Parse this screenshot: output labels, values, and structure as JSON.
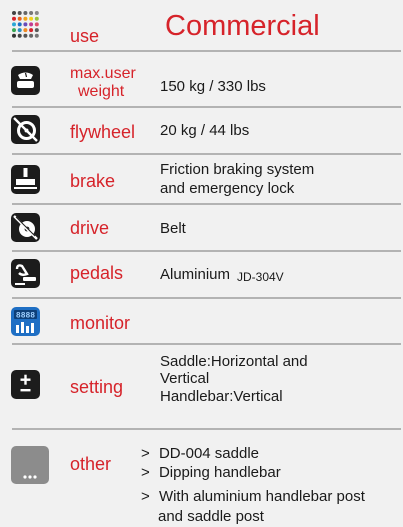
{
  "rows": {
    "use": {
      "label": "use",
      "value": "Commercial"
    },
    "max_user_weight": {
      "label_line1": "max.user",
      "label_line2": "weight",
      "value": "150 kg / 330 lbs"
    },
    "flywheel": {
      "label": "flywheel",
      "value": "20 kg / 44 lbs"
    },
    "brake": {
      "label": "brake",
      "value_line1": "Friction braking system",
      "value_line2": "and emergency lock"
    },
    "drive": {
      "label": "drive",
      "value": "Belt"
    },
    "pedals": {
      "label": "pedals",
      "value": "Aluminium",
      "model": "JD-304V"
    },
    "monitor": {
      "label": "monitor",
      "display_digits": "8888"
    },
    "setting": {
      "label": "setting",
      "value_line1": "Saddle:Horizontal and",
      "value_line2": "Vertical",
      "value_line3": "Handlebar:Vertical"
    },
    "other": {
      "label": "other",
      "bullet": ">",
      "items": [
        "DD-004 saddle",
        "Dipping handlebar",
        "With aluminium handlebar post",
        "and saddle post"
      ]
    }
  },
  "colors": {
    "label_red": "#d6232a",
    "icon_dark": "#1c1c1c",
    "divider": "#b3b3b3",
    "monitor_blue": "#1f6fc4",
    "other_gray": "#8c8c8c"
  },
  "icons": [
    "dot-grid-icon",
    "scale-icon",
    "flywheel-icon",
    "brake-icon",
    "drive-disabled-icon",
    "pedal-icon",
    "monitor-display-icon",
    "plus-minus-icon",
    "more-icon"
  ]
}
